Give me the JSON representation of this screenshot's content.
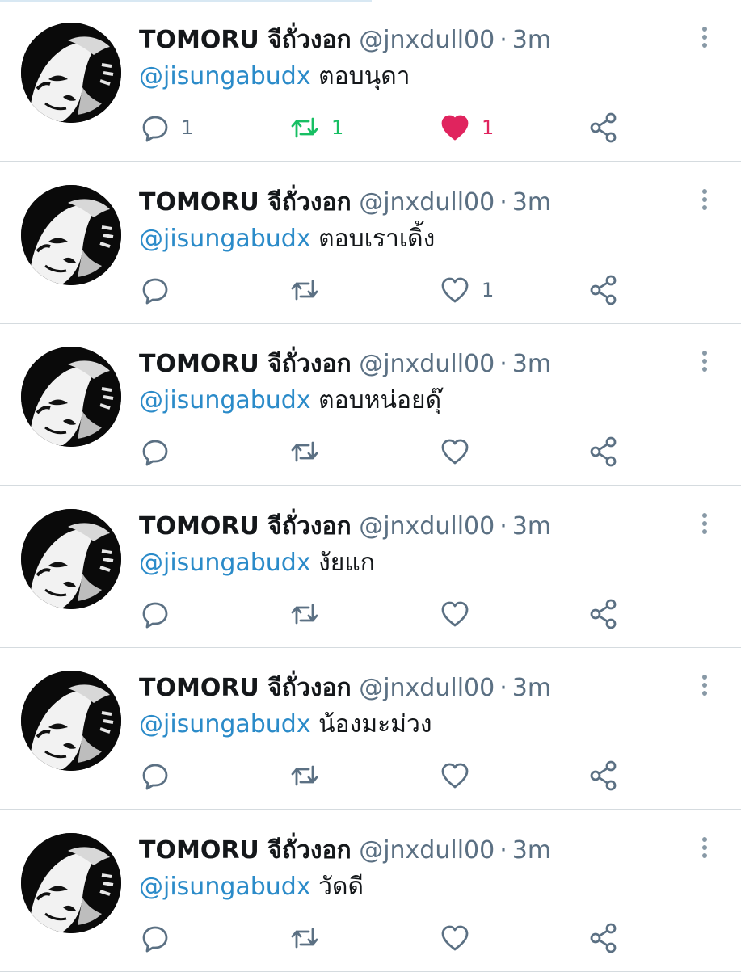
{
  "tweets": [
    {
      "name": "TOMORU จีถั่วงอก",
      "handle": "@jnxdull00",
      "separator": "·",
      "time": "3m",
      "mention": "@jisungabudx",
      "text": " ตอบนุดา",
      "reply_count": "1",
      "retweet_count": "1",
      "like_count": "1",
      "retweeted": true,
      "liked": true
    },
    {
      "name": "TOMORU จีถั่วงอก",
      "handle": "@jnxdull00",
      "separator": "·",
      "time": "3m",
      "mention": "@jisungabudx",
      "text": " ตอบเราเดิ้ง",
      "reply_count": "",
      "retweet_count": "",
      "like_count": "1",
      "retweeted": false,
      "liked": false
    },
    {
      "name": "TOMORU จีถั่วงอก",
      "handle": "@jnxdull00",
      "separator": "·",
      "time": "3m",
      "mention": "@jisungabudx",
      "text": " ตอบหน่อยดุ๊",
      "reply_count": "",
      "retweet_count": "",
      "like_count": "",
      "retweeted": false,
      "liked": false
    },
    {
      "name": "TOMORU จีถั่วงอก",
      "handle": "@jnxdull00",
      "separator": "·",
      "time": "3m",
      "mention": "@jisungabudx",
      "text": " งัยแก",
      "reply_count": "",
      "retweet_count": "",
      "like_count": "",
      "retweeted": false,
      "liked": false
    },
    {
      "name": "TOMORU จีถั่วงอก",
      "handle": "@jnxdull00",
      "separator": "·",
      "time": "3m",
      "mention": "@jisungabudx",
      "text": " น้องมะม่วง",
      "reply_count": "",
      "retweet_count": "",
      "like_count": "",
      "retweeted": false,
      "liked": false
    },
    {
      "name": "TOMORU จีถั่วงอก",
      "handle": "@jnxdull00",
      "separator": "·",
      "time": "3m",
      "mention": "@jisungabudx",
      "text": " วัดดี",
      "reply_count": "",
      "retweet_count": "",
      "like_count": "",
      "retweeted": false,
      "liked": false
    }
  ],
  "icons": {
    "reply": "reply-icon",
    "retweet": "retweet-icon",
    "like": "heart-icon",
    "share": "share-icon",
    "more": "more-vertical-icon"
  },
  "colors": {
    "mention": "#2b8bc9",
    "muted": "#5b7083",
    "retweet_active": "#17bf63",
    "like_active": "#e0245e",
    "divider": "#d5dbdf"
  }
}
